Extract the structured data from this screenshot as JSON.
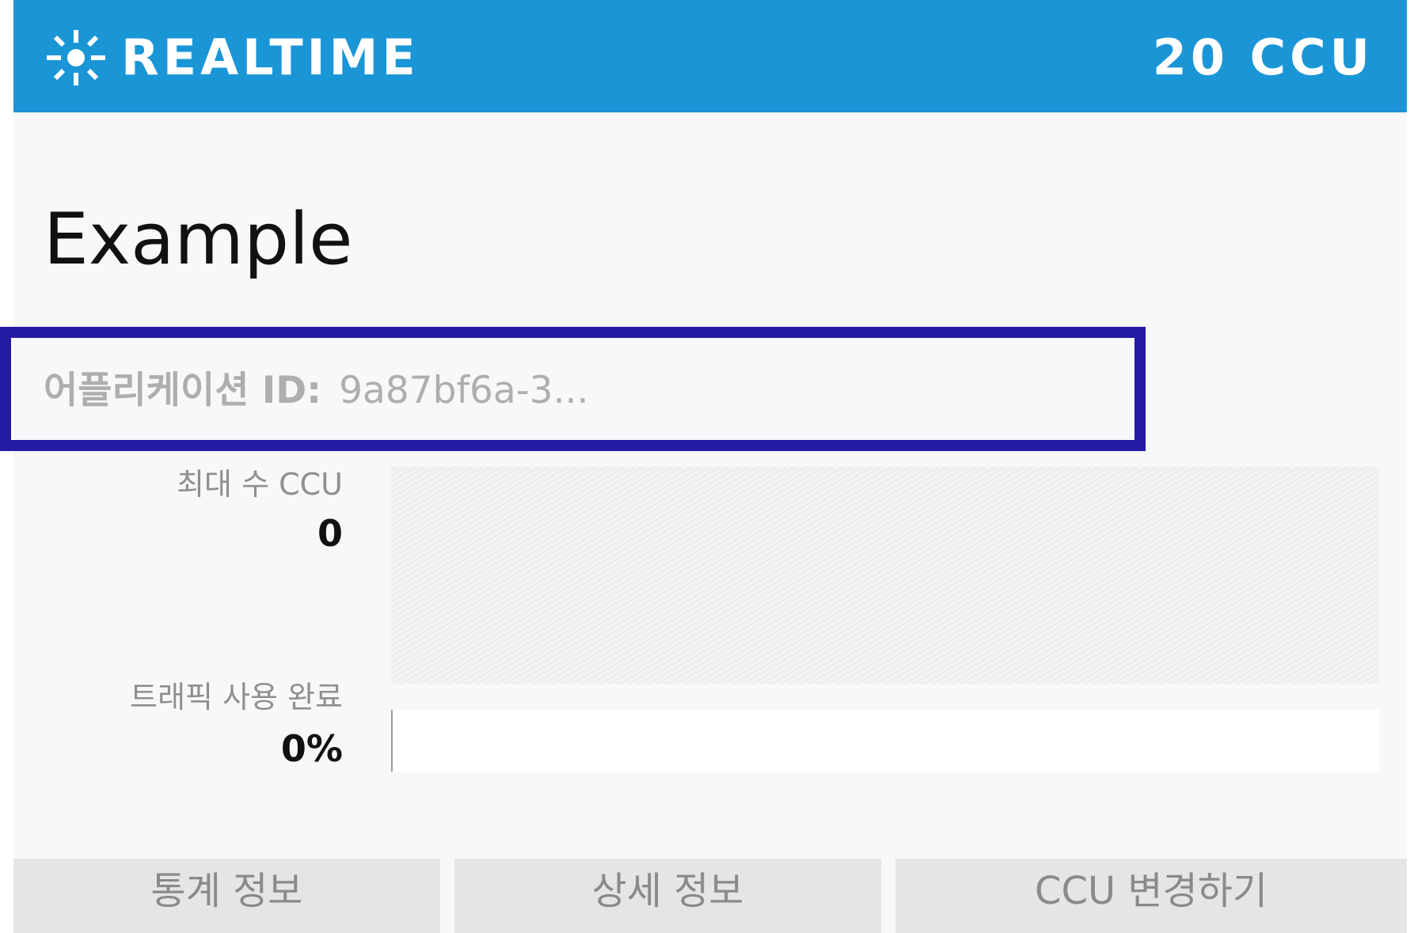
{
  "header": {
    "brand": "REALTIME",
    "ccu": "20 CCU",
    "icon": "sparkle-icon",
    "background_color": "#1a96d7"
  },
  "app": {
    "title": "Example",
    "id_label": "어플리케이션 ID:",
    "id_value": "9a87bf6a-3..."
  },
  "stats": {
    "max_ccu_label": "최대 수 CCU",
    "max_ccu_value": "0",
    "traffic_label": "트래픽 사용 완료",
    "traffic_value": "0%",
    "traffic_fraction": 0
  },
  "buttons": {
    "stats_label": "통계 정보",
    "details_label": "상세 정보",
    "change_ccu_label": "CCU 변경하기"
  },
  "highlight_color": "#241aa3"
}
